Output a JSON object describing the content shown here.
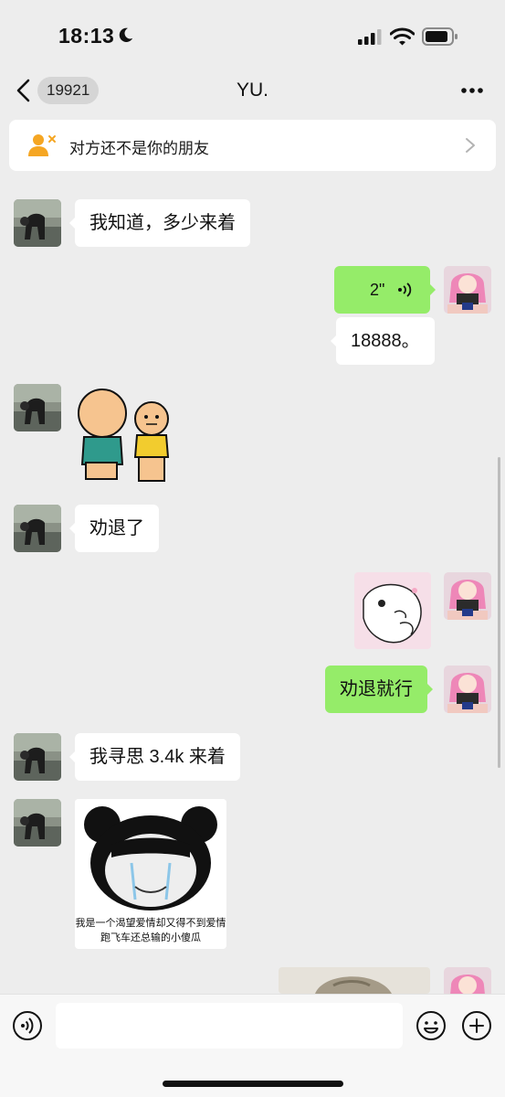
{
  "status_bar": {
    "time": "18:13",
    "icons": [
      "moon-icon",
      "cellular-signal-icon",
      "wifi-icon",
      "battery-icon"
    ]
  },
  "nav": {
    "back_badge": "19921",
    "title": "YU.",
    "back_icon": "chevron-left-icon",
    "more_icon": "more-dots-icon"
  },
  "banner": {
    "text": "对方还不是你的朋友",
    "icon": "user-remove-icon",
    "chevron": "chevron-right-icon"
  },
  "messages": [
    {
      "sender": "other",
      "type": "text",
      "text": "我知道，多少来着"
    },
    {
      "sender": "me",
      "type": "voice",
      "duration": "2\""
    },
    {
      "sender": "me",
      "type": "text",
      "text": "18888。"
    },
    {
      "sender": "other",
      "type": "sticker",
      "sticker": "cartoon-duo-sticker"
    },
    {
      "sender": "other",
      "type": "text",
      "text": "劝退了"
    },
    {
      "sender": "me",
      "type": "sticker",
      "sticker": "pink-seal-sticker"
    },
    {
      "sender": "me",
      "type": "text",
      "text": "劝退就行"
    },
    {
      "sender": "other",
      "type": "text",
      "text": "我寻思 3.4k 来着"
    },
    {
      "sender": "other",
      "type": "sticker",
      "sticker": "panda-meme-sticker",
      "caption_line1": "我是一个渴望爱情却又得不到爱情",
      "caption_line2": "跑飞车还总输的小傻瓜"
    },
    {
      "sender": "me",
      "type": "sticker",
      "sticker": "cat-photo-sticker"
    }
  ],
  "input_bar": {
    "placeholder": "",
    "voice_icon": "voice-input-icon",
    "emoji_icon": "emoji-icon",
    "plus_icon": "plus-icon"
  },
  "colors": {
    "background": "#ededed",
    "bubble_out": "#95ec69",
    "bubble_in": "#ffffff",
    "banner_icon": "#f5a623"
  }
}
